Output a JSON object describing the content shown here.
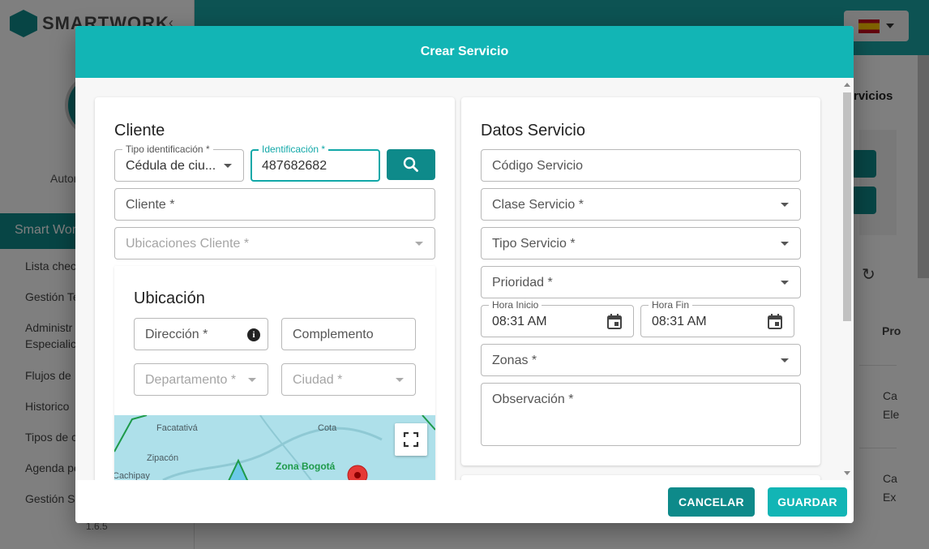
{
  "background": {
    "brand": "SMARTWORK",
    "sidebar_user_text": "Autor",
    "menu_header": "Smart Wor",
    "menu_items": [
      "Lista chec",
      "Gestión Te",
      "Administr",
      "Especialic",
      "Flujos de",
      "Historico",
      "Tipos de c",
      "Agenda pe",
      "Gestión S"
    ],
    "version": "1.6.5",
    "right_title": "rvicios",
    "right_col_header": "Pro",
    "right_rows": [
      "Ca",
      "Ele",
      "Ca",
      "Ex"
    ],
    "language_flag": "spain-flag-icon"
  },
  "modal": {
    "title": "Crear Servicio",
    "cliente": {
      "title": "Cliente",
      "tipo_identificacion": {
        "label": "Tipo identificación *",
        "value": "Cédula de ciu..."
      },
      "identificacion": {
        "label": "Identificación *",
        "value": "487682682"
      },
      "cliente_placeholder": "Cliente *",
      "ubicaciones_placeholder": "Ubicaciones Cliente *"
    },
    "ubicacion": {
      "title": "Ubicación",
      "direccion_placeholder": "Dirección *",
      "complemento_placeholder": "Complemento",
      "departamento_placeholder": "Departamento *",
      "ciudad_placeholder": "Ciudad *"
    },
    "map": {
      "labels": [
        "Facatativá",
        "Cota",
        "Zipacón",
        "Cachipay"
      ],
      "zone_label": "Zona Bogotá"
    },
    "datos_servicio": {
      "title": "Datos Servicio",
      "codigo_placeholder": "Código Servicio",
      "clase_placeholder": "Clase Servicio *",
      "tipo_placeholder": "Tipo Servicio *",
      "prioridad_placeholder": "Prioridad *",
      "hora_inicio": {
        "label": "Hora Inicio",
        "value": "08:31 AM"
      },
      "hora_fin": {
        "label": "Hora Fin",
        "value": "08:31 AM"
      },
      "zonas_placeholder": "Zonas *",
      "observacion_placeholder": "Observación *"
    },
    "buttons": {
      "cancel": "CANCELAR",
      "save": "GUARDAR"
    }
  },
  "colors": {
    "header": "#12b5b5",
    "primary_dark": "#0e8a8a",
    "focus": "#12a8a8"
  }
}
